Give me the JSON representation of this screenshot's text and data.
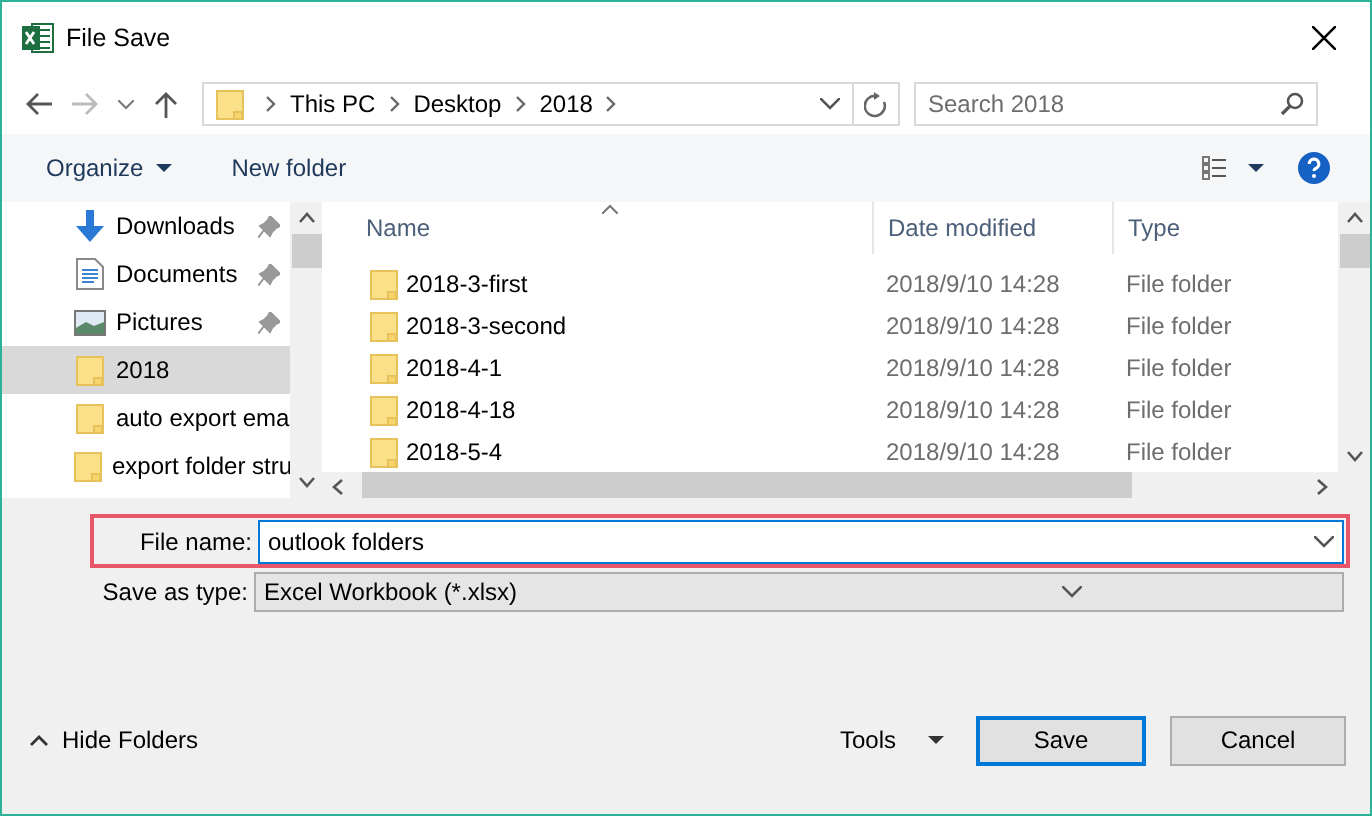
{
  "window": {
    "title": "File Save"
  },
  "breadcrumb": [
    "This PC",
    "Desktop",
    "2018"
  ],
  "search": {
    "placeholder": "Search 2018"
  },
  "toolbar": {
    "organize": "Organize",
    "new_folder": "New folder"
  },
  "sidebar": {
    "items": [
      {
        "label": "Downloads",
        "kind": "downloads",
        "pinned": true,
        "selected": false
      },
      {
        "label": "Documents",
        "kind": "documents",
        "pinned": true,
        "selected": false
      },
      {
        "label": "Pictures",
        "kind": "pictures",
        "pinned": true,
        "selected": false
      },
      {
        "label": "2018",
        "kind": "folder",
        "pinned": false,
        "selected": true
      },
      {
        "label": "auto export ema",
        "kind": "folder",
        "pinned": false,
        "selected": false
      },
      {
        "label": "export folder stru",
        "kind": "folder",
        "pinned": false,
        "selected": false
      }
    ]
  },
  "file_list": {
    "columns": [
      "Name",
      "Date modified",
      "Type"
    ],
    "rows": [
      {
        "name": "2018-3-first",
        "date": "2018/9/10 14:28",
        "type": "File folder"
      },
      {
        "name": "2018-3-second",
        "date": "2018/9/10 14:28",
        "type": "File folder"
      },
      {
        "name": "2018-4-1",
        "date": "2018/9/10 14:28",
        "type": "File folder"
      },
      {
        "name": "2018-4-18",
        "date": "2018/9/10 14:28",
        "type": "File folder"
      },
      {
        "name": "2018-5-4",
        "date": "2018/9/10 14:28",
        "type": "File folder"
      }
    ]
  },
  "file_name": {
    "label": "File name:",
    "value": "outlook folders"
  },
  "save_as_type": {
    "label": "Save as type:",
    "value": "Excel Workbook (*.xlsx)"
  },
  "hide_folders": "Hide Folders",
  "tools": "Tools",
  "buttons": [
    "Save",
    "Cancel"
  ]
}
